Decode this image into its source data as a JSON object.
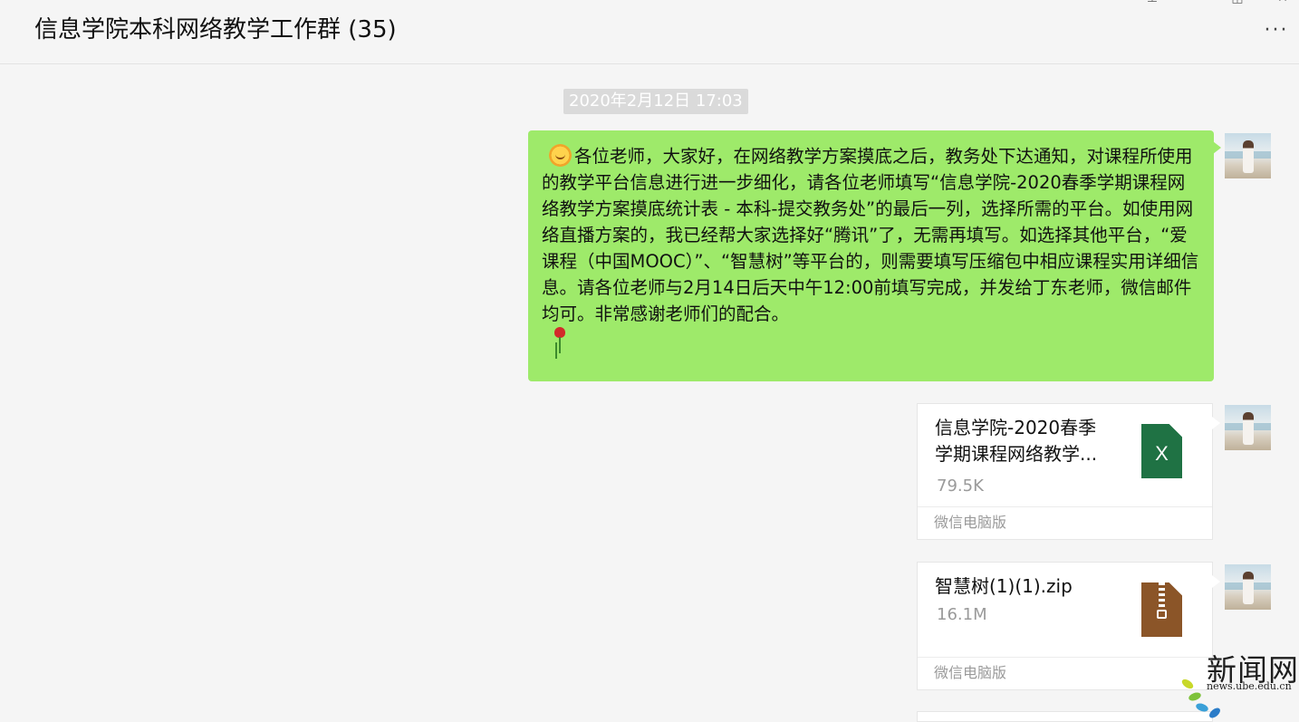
{
  "header": {
    "title": "信息学院本科网络教学工作群 (35)",
    "more_label": "···",
    "window_controls": [
      "pin-icon",
      "minimize-icon",
      "maximize-icon",
      "close-icon"
    ]
  },
  "chat": {
    "timestamp": "2020年2月12日 17:03",
    "messages": [
      {
        "type": "text",
        "icons": [
          "sun-emoji-icon",
          "rose-emoji-icon"
        ],
        "text": "各位老师，大家好，在网络教学方案摸底之后，教务处下达通知，对课程所使用的教学平台信息进行进一步细化，请各位老师填写“信息学院-2020春季学期课程网络教学方案摸底统计表 - 本科-提交教务处”的最后一列，选择所需的平台。如使用网络直播方案的，我已经帮大家选择好“腾讯”了，无需再填写。如选择其他平台，“爱课程（中国MOOC）”、“智慧树”等平台的，则需要填写压缩包中相应课程实用详细信息。请各位老师与2月14日后天中午12:00前填写完成，并发给丁东老师，微信邮件均可。非常感谢老师们的配合。"
      },
      {
        "type": "file",
        "name": "信息学院-2020春季学期课程网络教学...",
        "size": "79.5K",
        "source": "微信电脑版",
        "icon": "excel-file-icon",
        "icon_letter": "X",
        "icon_color": "#1f7244"
      },
      {
        "type": "file",
        "name": "智慧树(1)(1).zip",
        "size": "16.1M",
        "source": "微信电脑版",
        "icon": "zip-file-icon",
        "icon_color": "#8b5528"
      }
    ]
  },
  "colors": {
    "bubble_green": "#9eea6a",
    "background": "#f5f5f5"
  },
  "watermark": {
    "text": "新闻网",
    "url": "news.ube.edu.cn"
  }
}
